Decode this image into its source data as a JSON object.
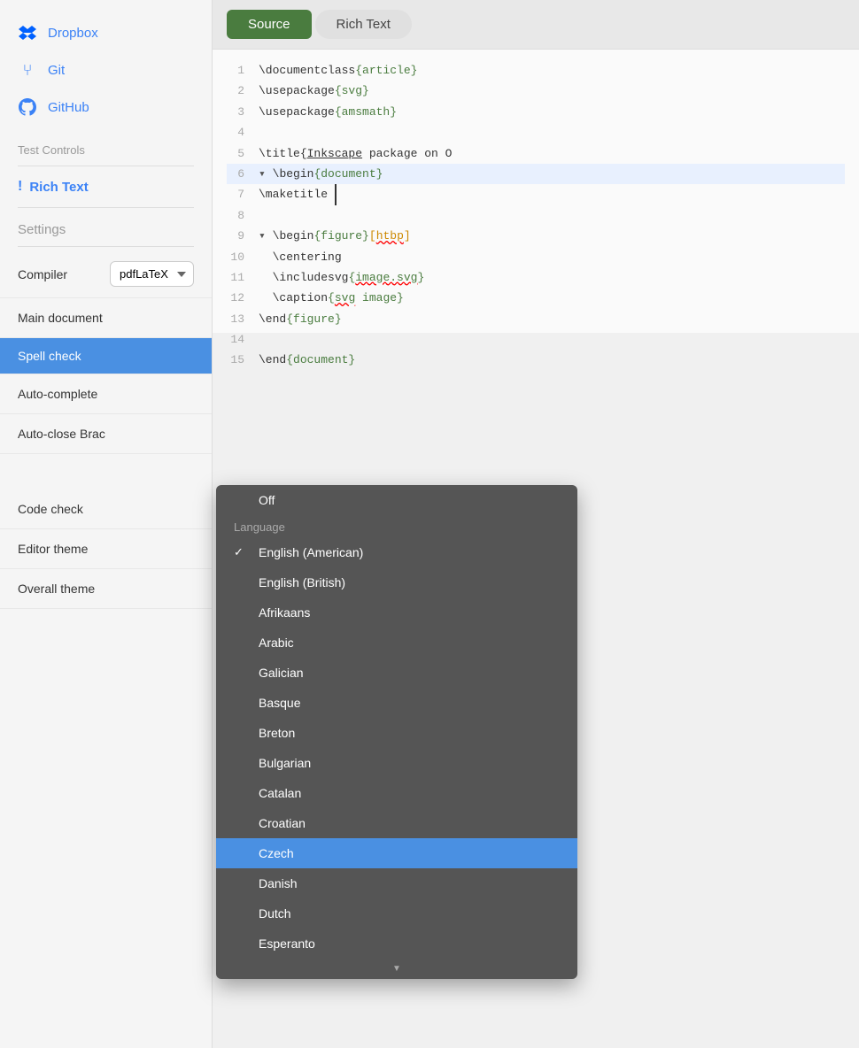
{
  "sidebar": {
    "nav_items": [
      {
        "id": "dropbox",
        "icon": "📦",
        "label": "Dropbox"
      },
      {
        "id": "git",
        "icon": "⑂",
        "label": "Git"
      },
      {
        "id": "github",
        "icon": "●",
        "label": "GitHub"
      }
    ],
    "test_controls_label": "Test Controls",
    "rich_text_label": "Rich Text",
    "settings_label": "Settings",
    "compiler_label": "Compiler",
    "compiler_value": "pdfLaTeX",
    "main_document_label": "Main document",
    "spell_check_label": "Spell check",
    "auto_complete_label": "Auto-complete",
    "auto_close_brac_label": "Auto-close Brac",
    "code_check_label": "Code check",
    "editor_theme_label": "Editor theme",
    "overall_theme_label": "Overall theme"
  },
  "editor": {
    "tab_source": "Source",
    "tab_richtext": "Rich Text",
    "code_lines": [
      {
        "num": "1",
        "content": "\\documentclass{article}"
      },
      {
        "num": "2",
        "content": "\\usepackage{svg}"
      },
      {
        "num": "3",
        "content": "\\usepackage{amsmath}"
      },
      {
        "num": "4",
        "content": ""
      },
      {
        "num": "5",
        "content": "\\title{Inkscape package on O"
      },
      {
        "num": "6",
        "content": "\\begin{document}"
      },
      {
        "num": "7",
        "content": "\\maketitle"
      },
      {
        "num": "8",
        "content": ""
      },
      {
        "num": "9",
        "content": "\\begin{figure}[htbp]"
      },
      {
        "num": "10",
        "content": "  \\centering"
      },
      {
        "num": "11",
        "content": "  \\includesvg{image.svg}"
      },
      {
        "num": "12",
        "content": "  \\caption{svg image}"
      },
      {
        "num": "13",
        "content": "\\end{figure}"
      },
      {
        "num": "14",
        "content": ""
      },
      {
        "num": "15",
        "content": "\\end{document}"
      }
    ]
  },
  "dropdown": {
    "off_label": "Off",
    "section_header": "Language",
    "items": [
      {
        "id": "english-american",
        "label": "English (American)",
        "checked": true
      },
      {
        "id": "english-british",
        "label": "English (British)",
        "checked": false
      },
      {
        "id": "afrikaans",
        "label": "Afrikaans",
        "checked": false
      },
      {
        "id": "arabic",
        "label": "Arabic",
        "checked": false
      },
      {
        "id": "galician",
        "label": "Galician",
        "checked": false
      },
      {
        "id": "basque",
        "label": "Basque",
        "checked": false
      },
      {
        "id": "breton",
        "label": "Breton",
        "checked": false
      },
      {
        "id": "bulgarian",
        "label": "Bulgarian",
        "checked": false
      },
      {
        "id": "catalan",
        "label": "Catalan",
        "checked": false
      },
      {
        "id": "croatian",
        "label": "Croatian",
        "checked": false
      },
      {
        "id": "czech",
        "label": "Czech",
        "checked": false,
        "selected": true
      },
      {
        "id": "danish",
        "label": "Danish",
        "checked": false
      },
      {
        "id": "dutch",
        "label": "Dutch",
        "checked": false
      },
      {
        "id": "esperanto",
        "label": "Esperanto",
        "checked": false
      }
    ],
    "scroll_indicator": "▼"
  }
}
